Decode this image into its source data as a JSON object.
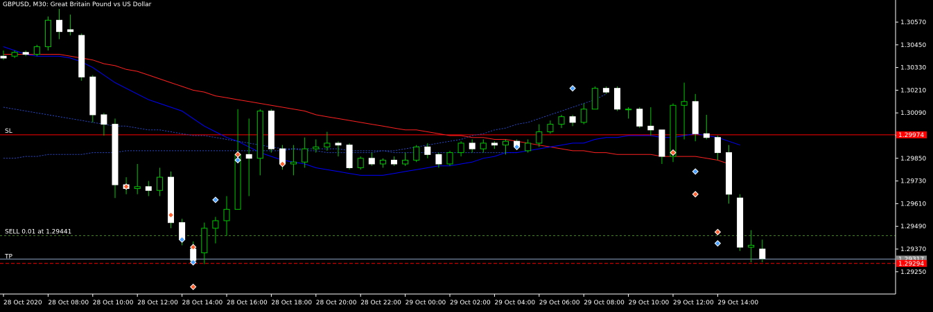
{
  "header": {
    "symbol_line": "GBPUSD, M30:  Great Britain Pound vs US Dollar"
  },
  "colors": {
    "background": "#000000",
    "bull_body": "#000000",
    "bear_body": "#ffffff",
    "wick": "#00c800",
    "bull_border": "#00c800",
    "ma_fast": "#0000ff",
    "ma_slow": "#ff2020",
    "ma_dots": "#2a4ad0",
    "sl_line": "#ff0000",
    "tp_line": "#8aa0c0",
    "entry_line": "#4a8a2a",
    "price_line": "#ff0000",
    "sl_tag_bg": "#ff0000",
    "current_tag_bg": "#888888",
    "axis": "#ffffff"
  },
  "levels": {
    "sl": {
      "label": "SL",
      "price": 1.29974,
      "tag": "1.29974"
    },
    "entry": {
      "label": "SELL 0.01 at 1.29441",
      "price": 1.29441
    },
    "tp": {
      "label": "TP",
      "price": 1.29317,
      "tag": "1.29317"
    },
    "current": {
      "price": 1.29294,
      "tag": "1.29294"
    }
  },
  "chart_data": {
    "type": "candlestick",
    "title": "GBPUSD, M30:  Great Britain Pound vs US Dollar",
    "ylim": [
      1.292,
      1.3072
    ],
    "y_ticks": [
      "1.30570",
      "1.30450",
      "1.30330",
      "1.30210",
      "1.30090",
      "1.29970",
      "1.29850",
      "1.29730",
      "1.29610",
      "1.29490",
      "1.29370",
      "1.29250"
    ],
    "y_tick_values": [
      1.3057,
      1.3045,
      1.3033,
      1.3021,
      1.3009,
      1.2997,
      1.2985,
      1.2973,
      1.2961,
      1.2949,
      1.2937,
      1.2925
    ],
    "x_labels": [
      "28 Oct 2020",
      "28 Oct 08:00",
      "28 Oct 10:00",
      "28 Oct 12:00",
      "28 Oct 14:00",
      "28 Oct 16:00",
      "28 Oct 18:00",
      "28 Oct 20:00",
      "28 Oct 22:00",
      "29 Oct 00:00",
      "29 Oct 02:00",
      "29 Oct 04:00",
      "29 Oct 06:00",
      "29 Oct 08:00",
      "29 Oct 10:00",
      "29 Oct 12:00",
      "29 Oct 14:00"
    ],
    "x_label_index": [
      0,
      4,
      8,
      12,
      16,
      20,
      24,
      28,
      32,
      36,
      40,
      44,
      48,
      52,
      56,
      60,
      64
    ],
    "candles": [
      [
        1.3039,
        1.3042,
        1.3037,
        1.3038
      ],
      [
        1.3039,
        1.3042,
        1.3038,
        1.3041
      ],
      [
        1.3041,
        1.3042,
        1.3039,
        1.304
      ],
      [
        1.304,
        1.3045,
        1.3039,
        1.3044
      ],
      [
        1.3044,
        1.306,
        1.3042,
        1.3058
      ],
      [
        1.3058,
        1.3064,
        1.3048,
        1.3052
      ],
      [
        1.3053,
        1.3061,
        1.305,
        1.3052
      ],
      [
        1.305,
        1.3051,
        1.3026,
        1.3028
      ],
      [
        1.3028,
        1.3029,
        1.3004,
        1.3008
      ],
      [
        1.3008,
        1.3009,
        1.2997,
        1.3003
      ],
      [
        1.3003,
        1.3006,
        1.2964,
        1.2971
      ],
      [
        1.2971,
        1.2975,
        1.2966,
        1.2969
      ],
      [
        1.2969,
        1.2982,
        1.2966,
        1.297
      ],
      [
        1.297,
        1.2973,
        1.2965,
        1.2968
      ],
      [
        1.2968,
        1.298,
        1.2965,
        1.2975
      ],
      [
        1.2975,
        1.2978,
        1.2948,
        1.2951
      ],
      [
        1.2951,
        1.2953,
        1.2939,
        1.2942
      ],
      [
        1.2937,
        1.2941,
        1.2929,
        1.2931
      ],
      [
        1.2935,
        1.2951,
        1.2929,
        1.2948
      ],
      [
        1.2948,
        1.2954,
        1.294,
        1.2952
      ],
      [
        1.2952,
        1.2965,
        1.2944,
        1.2958
      ],
      [
        1.2958,
        1.3011,
        1.2958,
        1.2987
      ],
      [
        1.2987,
        1.3006,
        1.2965,
        1.2985
      ],
      [
        1.2985,
        1.3011,
        1.2976,
        1.301
      ],
      [
        1.301,
        1.3011,
        1.2988,
        1.299
      ],
      [
        1.299,
        1.2992,
        1.2979,
        1.2982
      ],
      [
        1.2982,
        1.2992,
        1.2976,
        1.2983
      ],
      [
        1.2983,
        1.2996,
        1.298,
        1.299
      ],
      [
        1.299,
        1.2995,
        1.2988,
        1.2991
      ],
      [
        1.2991,
        1.2999,
        1.2989,
        1.2993
      ],
      [
        1.2993,
        1.2994,
        1.2986,
        1.2992
      ],
      [
        1.2992,
        1.2993,
        1.2979,
        1.298
      ],
      [
        1.298,
        1.2986,
        1.2979,
        1.2985
      ],
      [
        1.2985,
        1.2988,
        1.2981,
        1.2982
      ],
      [
        1.2982,
        1.2985,
        1.298,
        1.2984
      ],
      [
        1.2984,
        1.2986,
        1.2981,
        1.2982
      ],
      [
        1.2982,
        1.2988,
        1.2981,
        1.2984
      ],
      [
        1.2984,
        1.2992,
        1.2983,
        1.2991
      ],
      [
        1.2991,
        1.2993,
        1.2985,
        1.2987
      ],
      [
        1.2987,
        1.2988,
        1.298,
        1.2982
      ],
      [
        1.2982,
        1.2989,
        1.2981,
        1.2988
      ],
      [
        1.2988,
        1.2994,
        1.2986,
        1.2993
      ],
      [
        1.2993,
        1.2995,
        1.2988,
        1.299
      ],
      [
        1.299,
        1.2995,
        1.2988,
        1.2993
      ],
      [
        1.2993,
        1.2994,
        1.299,
        1.2992
      ],
      [
        1.2992,
        1.2995,
        1.2987,
        1.2994
      ],
      [
        1.2994,
        1.2995,
        1.299,
        1.2991
      ],
      [
        1.2989,
        1.2995,
        1.2988,
        1.2993
      ],
      [
        1.2993,
        1.3003,
        1.2991,
        1.2999
      ],
      [
        1.2999,
        1.3005,
        1.2998,
        1.3003
      ],
      [
        1.3003,
        1.3008,
        1.3001,
        1.3007
      ],
      [
        1.3007,
        1.3008,
        1.3002,
        1.3004
      ],
      [
        1.3004,
        1.3014,
        1.3003,
        1.3011
      ],
      [
        1.3011,
        1.3023,
        1.3011,
        1.3022
      ],
      [
        1.3022,
        1.3023,
        1.3019,
        1.302
      ],
      [
        1.3022,
        1.3023,
        1.301,
        1.3011
      ],
      [
        1.3011,
        1.3012,
        1.3006,
        1.3011
      ],
      [
        1.3011,
        1.3012,
        1.3001,
        1.3002
      ],
      [
        1.3002,
        1.3012,
        1.2997,
        1.3
      ],
      [
        1.3,
        1.3,
        1.2982,
        1.2986
      ],
      [
        1.2986,
        1.3014,
        1.2983,
        1.3013
      ],
      [
        1.3013,
        1.3025,
        1.2995,
        1.3015
      ],
      [
        1.3015,
        1.3019,
        1.2994,
        1.2998
      ],
      [
        1.2998,
        1.3008,
        1.2995,
        1.2996
      ],
      [
        1.2996,
        1.2997,
        1.2984,
        1.2988
      ],
      [
        1.2988,
        1.2992,
        1.2961,
        1.2966
      ],
      [
        1.2964,
        1.2966,
        1.2936,
        1.2938
      ],
      [
        1.2938,
        1.2947,
        1.293,
        1.2939
      ],
      [
        1.2937,
        1.2942,
        1.293,
        1.2932
      ]
    ],
    "ma_fast": [
      1.3044,
      1.3042,
      1.304,
      1.3039,
      1.3039,
      1.3039,
      1.3038,
      1.3036,
      1.3033,
      1.3029,
      1.3025,
      1.3022,
      1.3019,
      1.3016,
      1.3014,
      1.3012,
      1.301,
      1.3006,
      1.3002,
      1.2999,
      1.2996,
      1.2994,
      1.2991,
      1.2988,
      1.2986,
      1.2984,
      1.2983,
      1.2982,
      1.298,
      1.2979,
      1.2978,
      1.2977,
      1.2976,
      1.2976,
      1.2976,
      1.2977,
      1.2978,
      1.2979,
      1.298,
      1.2981,
      1.2981,
      1.2982,
      1.2983,
      1.2985,
      1.2986,
      1.2988,
      1.2988,
      1.2989,
      1.299,
      1.2991,
      1.2992,
      1.2993,
      1.2993,
      1.2995,
      1.2996,
      1.2996,
      1.2997,
      1.2997,
      1.2997,
      1.2996,
      1.2996,
      1.2997,
      1.2998,
      1.2997,
      1.2996,
      1.2994,
      1.2992
    ],
    "ma_slow": [
      1.304,
      1.304,
      1.304,
      1.304,
      1.304,
      1.304,
      1.3039,
      1.3038,
      1.3037,
      1.3035,
      1.3034,
      1.3032,
      1.3031,
      1.3029,
      1.3027,
      1.3025,
      1.3023,
      1.3021,
      1.302,
      1.3018,
      1.3017,
      1.3016,
      1.3015,
      1.3014,
      1.3013,
      1.3012,
      1.3011,
      1.301,
      1.3008,
      1.3007,
      1.3006,
      1.3005,
      1.3004,
      1.3003,
      1.3002,
      1.3001,
      1.3,
      1.3,
      1.2999,
      1.2998,
      1.2997,
      1.2997,
      1.2996,
      1.2996,
      1.2995,
      1.2995,
      1.2994,
      1.2993,
      1.2992,
      1.2991,
      1.299,
      1.2989,
      1.2989,
      1.2988,
      1.2988,
      1.2987,
      1.2987,
      1.2987,
      1.2987,
      1.2986,
      1.2986,
      1.2986,
      1.2986,
      1.2985,
      1.2984,
      1.2982
    ],
    "ma_dotted": [
      1.3012,
      1.3011,
      1.301,
      1.3009,
      1.3008,
      1.3007,
      1.3006,
      1.3005,
      1.3004,
      1.3003,
      1.3002,
      1.3002,
      1.3001,
      1.3,
      1.3,
      1.2999,
      1.2998,
      1.2997,
      1.2997,
      1.2996,
      1.2995,
      1.2994,
      1.2993,
      1.2992,
      1.2991,
      1.299,
      1.299,
      1.2989,
      1.2989,
      1.2988,
      1.2988,
      1.2988,
      1.2988,
      1.2988,
      1.2989,
      1.2989,
      1.299,
      1.2991,
      1.2992,
      1.2993,
      1.2994,
      1.2995,
      1.2997,
      1.2998,
      1.3,
      1.3001,
      1.3003,
      1.3004,
      1.3006,
      1.3008,
      1.301,
      1.3012,
      1.3014,
      1.3016,
      1.3019
    ],
    "ma_dotted_low": [
      1.2985,
      1.2985,
      1.2986,
      1.2986,
      1.2987,
      1.2987,
      1.2987,
      1.2987,
      1.2988,
      1.2988,
      1.2988,
      1.2989,
      1.2989,
      1.2989,
      1.2989,
      1.2989,
      1.2989,
      1.2989,
      1.2989,
      1.2989,
      1.2989,
      1.2989,
      1.2989,
      1.2989,
      1.2989,
      1.2989,
      1.299,
      1.299,
      1.299,
      1.299,
      1.299,
      1.2989,
      1.2989,
      1.2989,
      1.2989,
      1.2988,
      1.2988,
      1.2988,
      1.2988,
      1.2988,
      1.2988,
      1.2988,
      1.2988,
      1.2988,
      1.2988,
      1.2988,
      1.2988
    ],
    "trade_markers": [
      {
        "index": 11,
        "price": 1.297,
        "kind": "sell"
      },
      {
        "index": 15,
        "price": 1.2955,
        "kind": "sell"
      },
      {
        "index": 16,
        "price": 1.2942,
        "kind": "buy"
      },
      {
        "index": 17,
        "price": 1.2938,
        "kind": "sell"
      },
      {
        "index": 17,
        "price": 1.293,
        "kind": "buy"
      },
      {
        "index": 17,
        "price": 1.2917,
        "kind": "sell"
      },
      {
        "index": 19,
        "price": 1.2963,
        "kind": "buy"
      },
      {
        "index": 21,
        "price": 1.2987,
        "kind": "sell"
      },
      {
        "index": 21,
        "price": 1.2984,
        "kind": "buy"
      },
      {
        "index": 25,
        "price": 1.2982,
        "kind": "sell"
      },
      {
        "index": 46,
        "price": 1.2991,
        "kind": "buy"
      },
      {
        "index": 51,
        "price": 1.3022,
        "kind": "buy"
      },
      {
        "index": 60,
        "price": 1.2988,
        "kind": "sell"
      },
      {
        "index": 62,
        "price": 1.2978,
        "kind": "buy"
      },
      {
        "index": 62,
        "price": 1.2966,
        "kind": "sell"
      },
      {
        "index": 64,
        "price": 1.2946,
        "kind": "sell"
      },
      {
        "index": 64,
        "price": 1.294,
        "kind": "buy"
      }
    ]
  }
}
